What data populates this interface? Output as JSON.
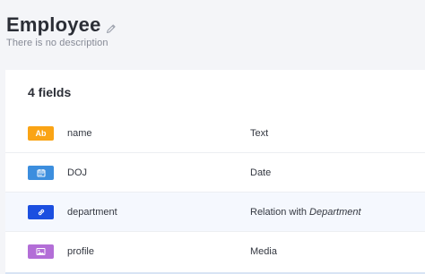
{
  "header": {
    "title": "Employee",
    "description": "There is no description"
  },
  "card": {
    "fields_count": "4 fields"
  },
  "fields": [
    {
      "name": "name",
      "type": "Text",
      "icon": "text-type-icon",
      "badge_label": "Ab",
      "color": "#faa415"
    },
    {
      "name": "DOJ",
      "type": "Date",
      "icon": "calendar-icon",
      "badge_label": "",
      "color": "#3c8ede"
    },
    {
      "name": "department",
      "type_prefix": "Relation with",
      "type_target": "Department",
      "icon": "relation-link-icon",
      "badge_label": "",
      "color": "#1c4fe0"
    },
    {
      "name": "profile",
      "type": "Media",
      "icon": "image-icon",
      "badge_label": "",
      "color": "#b36ed7"
    }
  ],
  "colors": {
    "background": "#f4f5f8",
    "card": "#ffffff",
    "highlight_row": "#f5f8fe"
  }
}
